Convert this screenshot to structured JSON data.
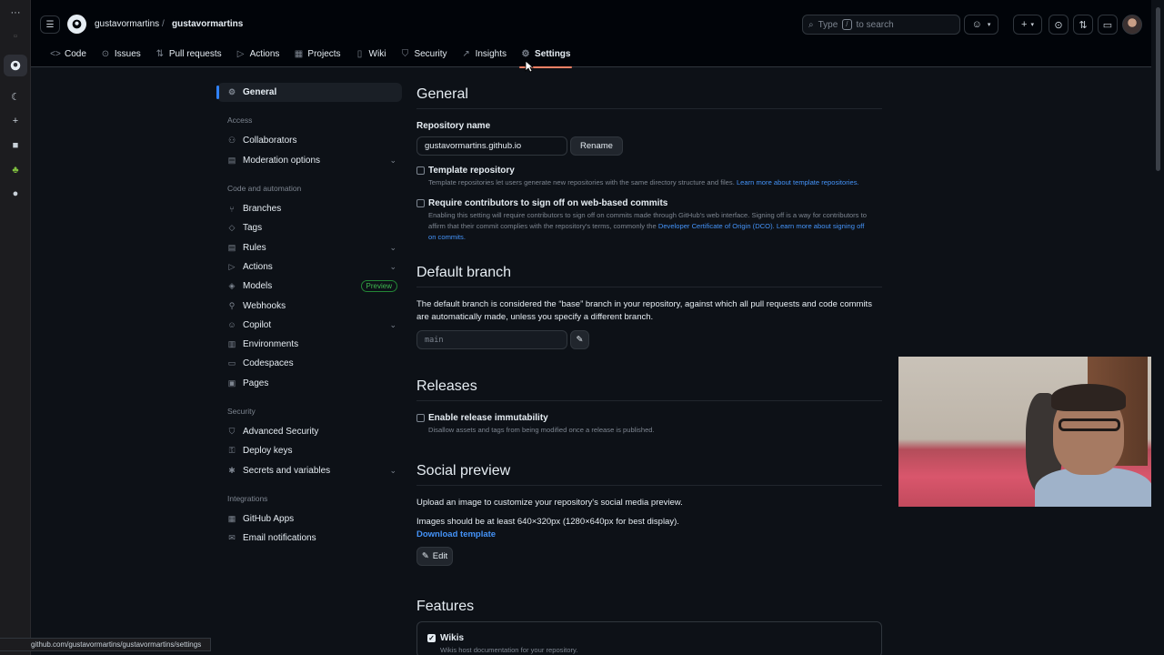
{
  "browser": {
    "status_url": "github.com/gustavormartins/gustavormartins/settings"
  },
  "header": {
    "owner": "gustavormartins",
    "separator": "/",
    "repo": "gustavormartins",
    "search_prefix": "Type",
    "search_key": "/",
    "search_suffix": "to search"
  },
  "tabs": [
    {
      "label": "Code",
      "icon": "code-icon"
    },
    {
      "label": "Issues",
      "icon": "issue-icon"
    },
    {
      "label": "Pull requests",
      "icon": "pull-request-icon"
    },
    {
      "label": "Actions",
      "icon": "play-icon"
    },
    {
      "label": "Projects",
      "icon": "table-icon"
    },
    {
      "label": "Wiki",
      "icon": "book-icon"
    },
    {
      "label": "Security",
      "icon": "shield-icon"
    },
    {
      "label": "Insights",
      "icon": "graph-icon"
    },
    {
      "label": "Settings",
      "icon": "gear-icon"
    }
  ],
  "sidebar": {
    "general": "General",
    "access_heading": "Access",
    "access": [
      "Collaborators",
      "Moderation options"
    ],
    "code_heading": "Code and automation",
    "code": [
      "Branches",
      "Tags",
      "Rules",
      "Actions",
      "Models",
      "Webhooks",
      "Copilot",
      "Environments",
      "Codespaces",
      "Pages"
    ],
    "models_badge": "Preview",
    "security_heading": "Security",
    "security": [
      "Advanced Security",
      "Deploy keys",
      "Secrets and variables"
    ],
    "integrations_heading": "Integrations",
    "integrations": [
      "GitHub Apps",
      "Email notifications"
    ]
  },
  "main": {
    "general_title": "General",
    "repo_name_label": "Repository name",
    "repo_name_value": "gustavormartins.github.io",
    "rename_button": "Rename",
    "template_label": "Template repository",
    "template_help": "Template repositories let users generate new repositories with the same directory structure and files.",
    "template_link": "Learn more about template repositories.",
    "signoff_label": "Require contributors to sign off on web-based commits",
    "signoff_help_1": "Enabling this setting will require contributors to sign off on commits made through GitHub's web interface. Signing off is a way for contributors to affirm that their commit complies with the repository's terms, commonly the",
    "signoff_link_1": "Developer Certificate of Origin (DCO).",
    "signoff_link_2": "Learn more about signing off on commits.",
    "default_branch_title": "Default branch",
    "default_branch_text": "The default branch is considered the “base” branch in your repository, against which all pull requests and code commits are automatically made, unless you specify a different branch.",
    "default_branch_value": "main",
    "releases_title": "Releases",
    "immutability_label": "Enable release immutability",
    "immutability_help": "Disallow assets and tags from being modified once a release is published.",
    "social_title": "Social preview",
    "social_text_1": "Upload an image to customize your repository's social media preview.",
    "social_text_2": "Images should be at least 640×320px (1280×640px for best display).",
    "download_template": "Download template",
    "edit_button": "Edit",
    "features_title": "Features",
    "wikis_label": "Wikis",
    "wikis_help": "Wikis host documentation for your repository."
  },
  "colors": {
    "background": "#0d1117",
    "header": "#010409",
    "accent_underline": "#f78166",
    "link": "#4493f8",
    "nav_active": "#2f81f7"
  }
}
